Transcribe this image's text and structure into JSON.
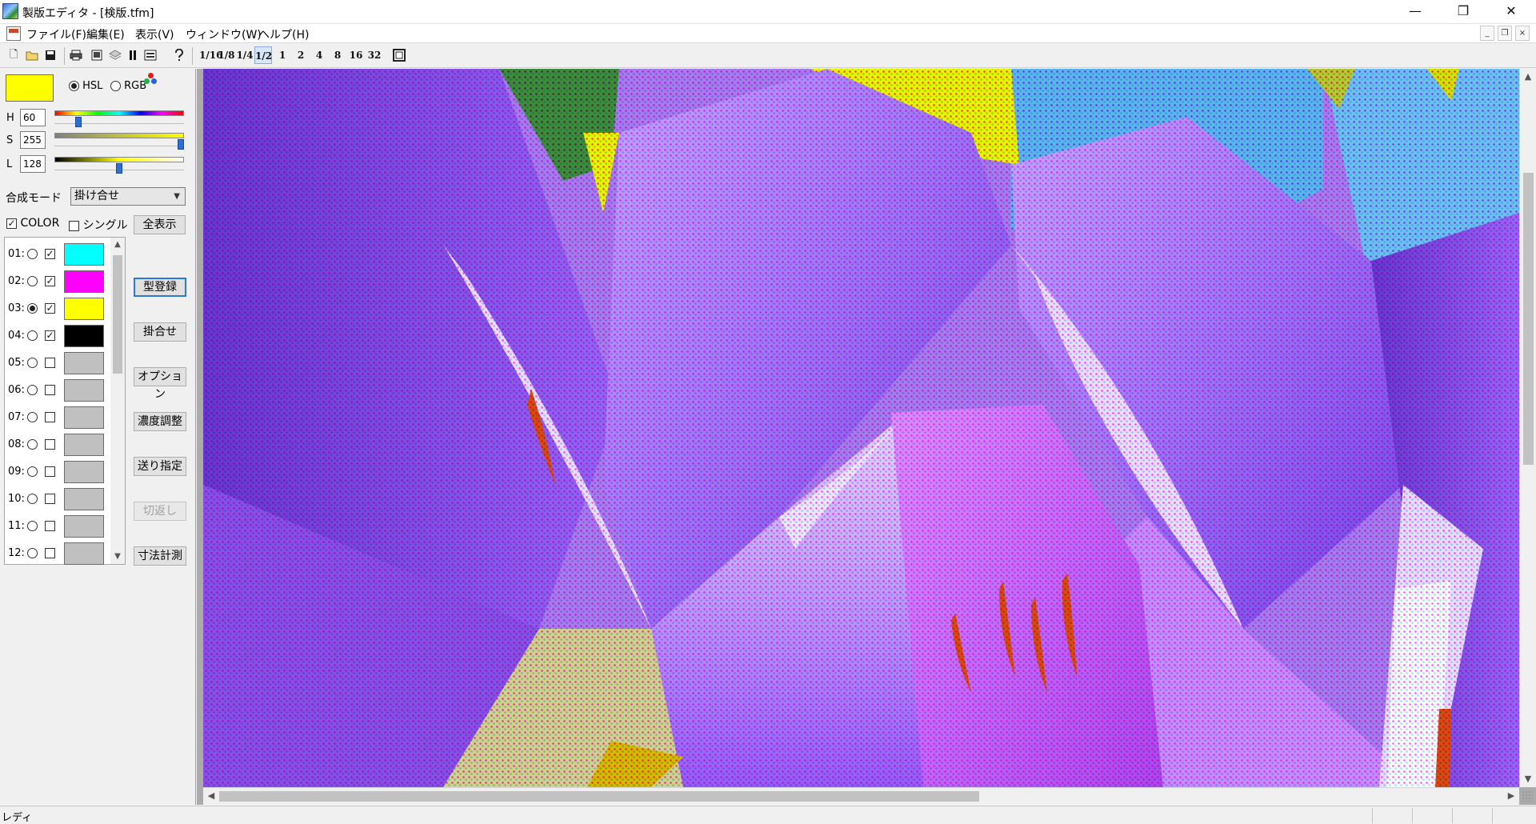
{
  "window": {
    "title": "製版エディタ - [検版.tfm]",
    "controls": [
      "—",
      "❐",
      "✕"
    ]
  },
  "menu": {
    "items": [
      "ファイル(F)",
      "編集(E)",
      "表示(V)",
      "ウィンドウ(W)",
      "ヘルプ(H)"
    ],
    "mdi_controls": [
      "_",
      "❐",
      "×"
    ]
  },
  "toolbar": {
    "file_icons": [
      "new-file-icon",
      "open-folder-icon",
      "save-icon",
      "print-icon",
      "page-icon",
      "layers-icon",
      "pause-icon",
      "list-icon",
      "help-icon"
    ],
    "zoom_levels": [
      "1/16",
      "1/8",
      "1/4",
      "1/2",
      "1",
      "2",
      "4",
      "8",
      "16",
      "32"
    ],
    "zoom_active": "1/2"
  },
  "color_panel": {
    "current_color": "#ffff00",
    "mode_hsl": "HSL",
    "mode_rgb": "RGB",
    "mode_selected": "HSL",
    "h_label": "H",
    "h_value": "60",
    "s_label": "S",
    "s_value": "255",
    "l_label": "L",
    "l_value": "128",
    "h_level": 0.17,
    "s_level": 1.0,
    "l_level": 0.5
  },
  "composite": {
    "label": "合成モード",
    "value": "掛け合せ"
  },
  "options": {
    "color_label": "COLOR",
    "color_checked": true,
    "single_label": "シングル",
    "single_checked": false,
    "show_all_button": "全表示"
  },
  "layers": [
    {
      "num": "01:",
      "selected": false,
      "visible": true,
      "color": "#00ffff"
    },
    {
      "num": "02:",
      "selected": false,
      "visible": true,
      "color": "#ff00ff"
    },
    {
      "num": "03:",
      "selected": true,
      "visible": true,
      "color": "#ffff00"
    },
    {
      "num": "04:",
      "selected": false,
      "visible": true,
      "color": "#000000"
    },
    {
      "num": "05:",
      "selected": false,
      "visible": false,
      "color": "#c0c0c0"
    },
    {
      "num": "06:",
      "selected": false,
      "visible": false,
      "color": "#c0c0c0"
    },
    {
      "num": "07:",
      "selected": false,
      "visible": false,
      "color": "#c0c0c0"
    },
    {
      "num": "08:",
      "selected": false,
      "visible": false,
      "color": "#c0c0c0"
    },
    {
      "num": "09:",
      "selected": false,
      "visible": false,
      "color": "#c0c0c0"
    },
    {
      "num": "10:",
      "selected": false,
      "visible": false,
      "color": "#c0c0c0"
    },
    {
      "num": "11:",
      "selected": false,
      "visible": false,
      "color": "#c0c0c0"
    },
    {
      "num": "12:",
      "selected": false,
      "visible": false,
      "color": "#c0c0c0"
    }
  ],
  "side_buttons": [
    {
      "label": "型登録",
      "enabled": true,
      "default": true
    },
    {
      "label": "掛合せ",
      "enabled": true,
      "default": false
    },
    {
      "label": "オプション",
      "enabled": true,
      "default": false
    },
    {
      "label": "濃度調整",
      "enabled": true,
      "default": false
    },
    {
      "label": "送り指定",
      "enabled": true,
      "default": false
    },
    {
      "label": "切返し",
      "enabled": false,
      "default": false
    },
    {
      "label": "寸法計測",
      "enabled": true,
      "default": false
    }
  ],
  "status": {
    "text": "レディ"
  },
  "colors": {
    "canvas_bg": "#ababab",
    "petal_purple": "#8b4fe0",
    "petal_light": "#d9b8ff",
    "accent_yellow": "#e9f500",
    "sky_blue": "#5ab6e8"
  }
}
